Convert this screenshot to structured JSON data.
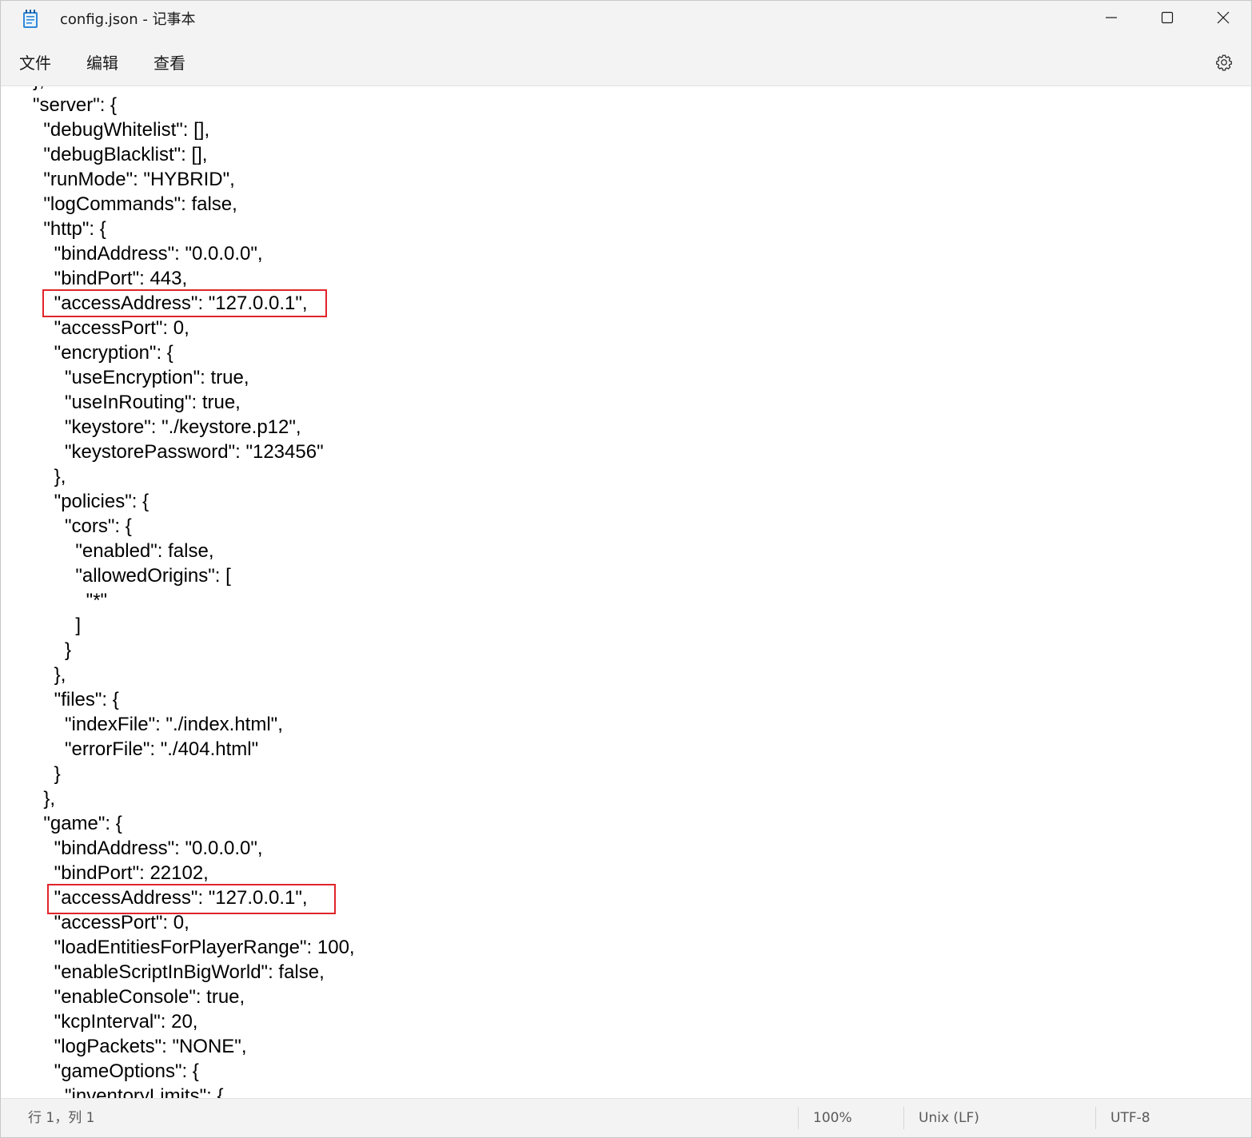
{
  "window": {
    "title": "config.json - 记事本",
    "icon": "notepad-icon",
    "controls": {
      "minimize_icon": "minimize-icon",
      "maximize_icon": "maximize-icon",
      "close_icon": "close-icon"
    }
  },
  "menu": {
    "items": [
      {
        "label": "文件"
      },
      {
        "label": "编辑"
      },
      {
        "label": "查看"
      }
    ],
    "settings_icon": "gear-icon"
  },
  "editor": {
    "lines": [
      "},",
      "\"server\": {",
      "  \"debugWhitelist\": [],",
      "  \"debugBlacklist\": [],",
      "  \"runMode\": \"HYBRID\",",
      "  \"logCommands\": false,",
      "  \"http\": {",
      "    \"bindAddress\": \"0.0.0.0\",",
      "    \"bindPort\": 443,",
      "    \"accessAddress\": \"127.0.0.1\",",
      "    \"accessPort\": 0,",
      "    \"encryption\": {",
      "      \"useEncryption\": true,",
      "      \"useInRouting\": true,",
      "      \"keystore\": \"./keystore.p12\",",
      "      \"keystorePassword\": \"123456\"",
      "    },",
      "    \"policies\": {",
      "      \"cors\": {",
      "        \"enabled\": false,",
      "        \"allowedOrigins\": [",
      "          \"*\"",
      "        ]",
      "      }",
      "    },",
      "    \"files\": {",
      "      \"indexFile\": \"./index.html\",",
      "      \"errorFile\": \"./404.html\"",
      "    }",
      "  },",
      "  \"game\": {",
      "    \"bindAddress\": \"0.0.0.0\",",
      "    \"bindPort\": 22102,",
      "    \"accessAddress\": \"127.0.0.1\",",
      "    \"accessPort\": 0,",
      "    \"loadEntitiesForPlayerRange\": 100,",
      "    \"enableScriptInBigWorld\": false,",
      "    \"enableConsole\": true,",
      "    \"kcpInterval\": 20,",
      "    \"logPackets\": \"NONE\",",
      "    \"gameOptions\": {",
      "      \"inventoryLimits\": {"
    ],
    "highlight_color": "#e0242a"
  },
  "status": {
    "position": "行 1，列 1",
    "zoom": "100%",
    "line_ending": "Unix (LF)",
    "encoding": "UTF-8"
  }
}
